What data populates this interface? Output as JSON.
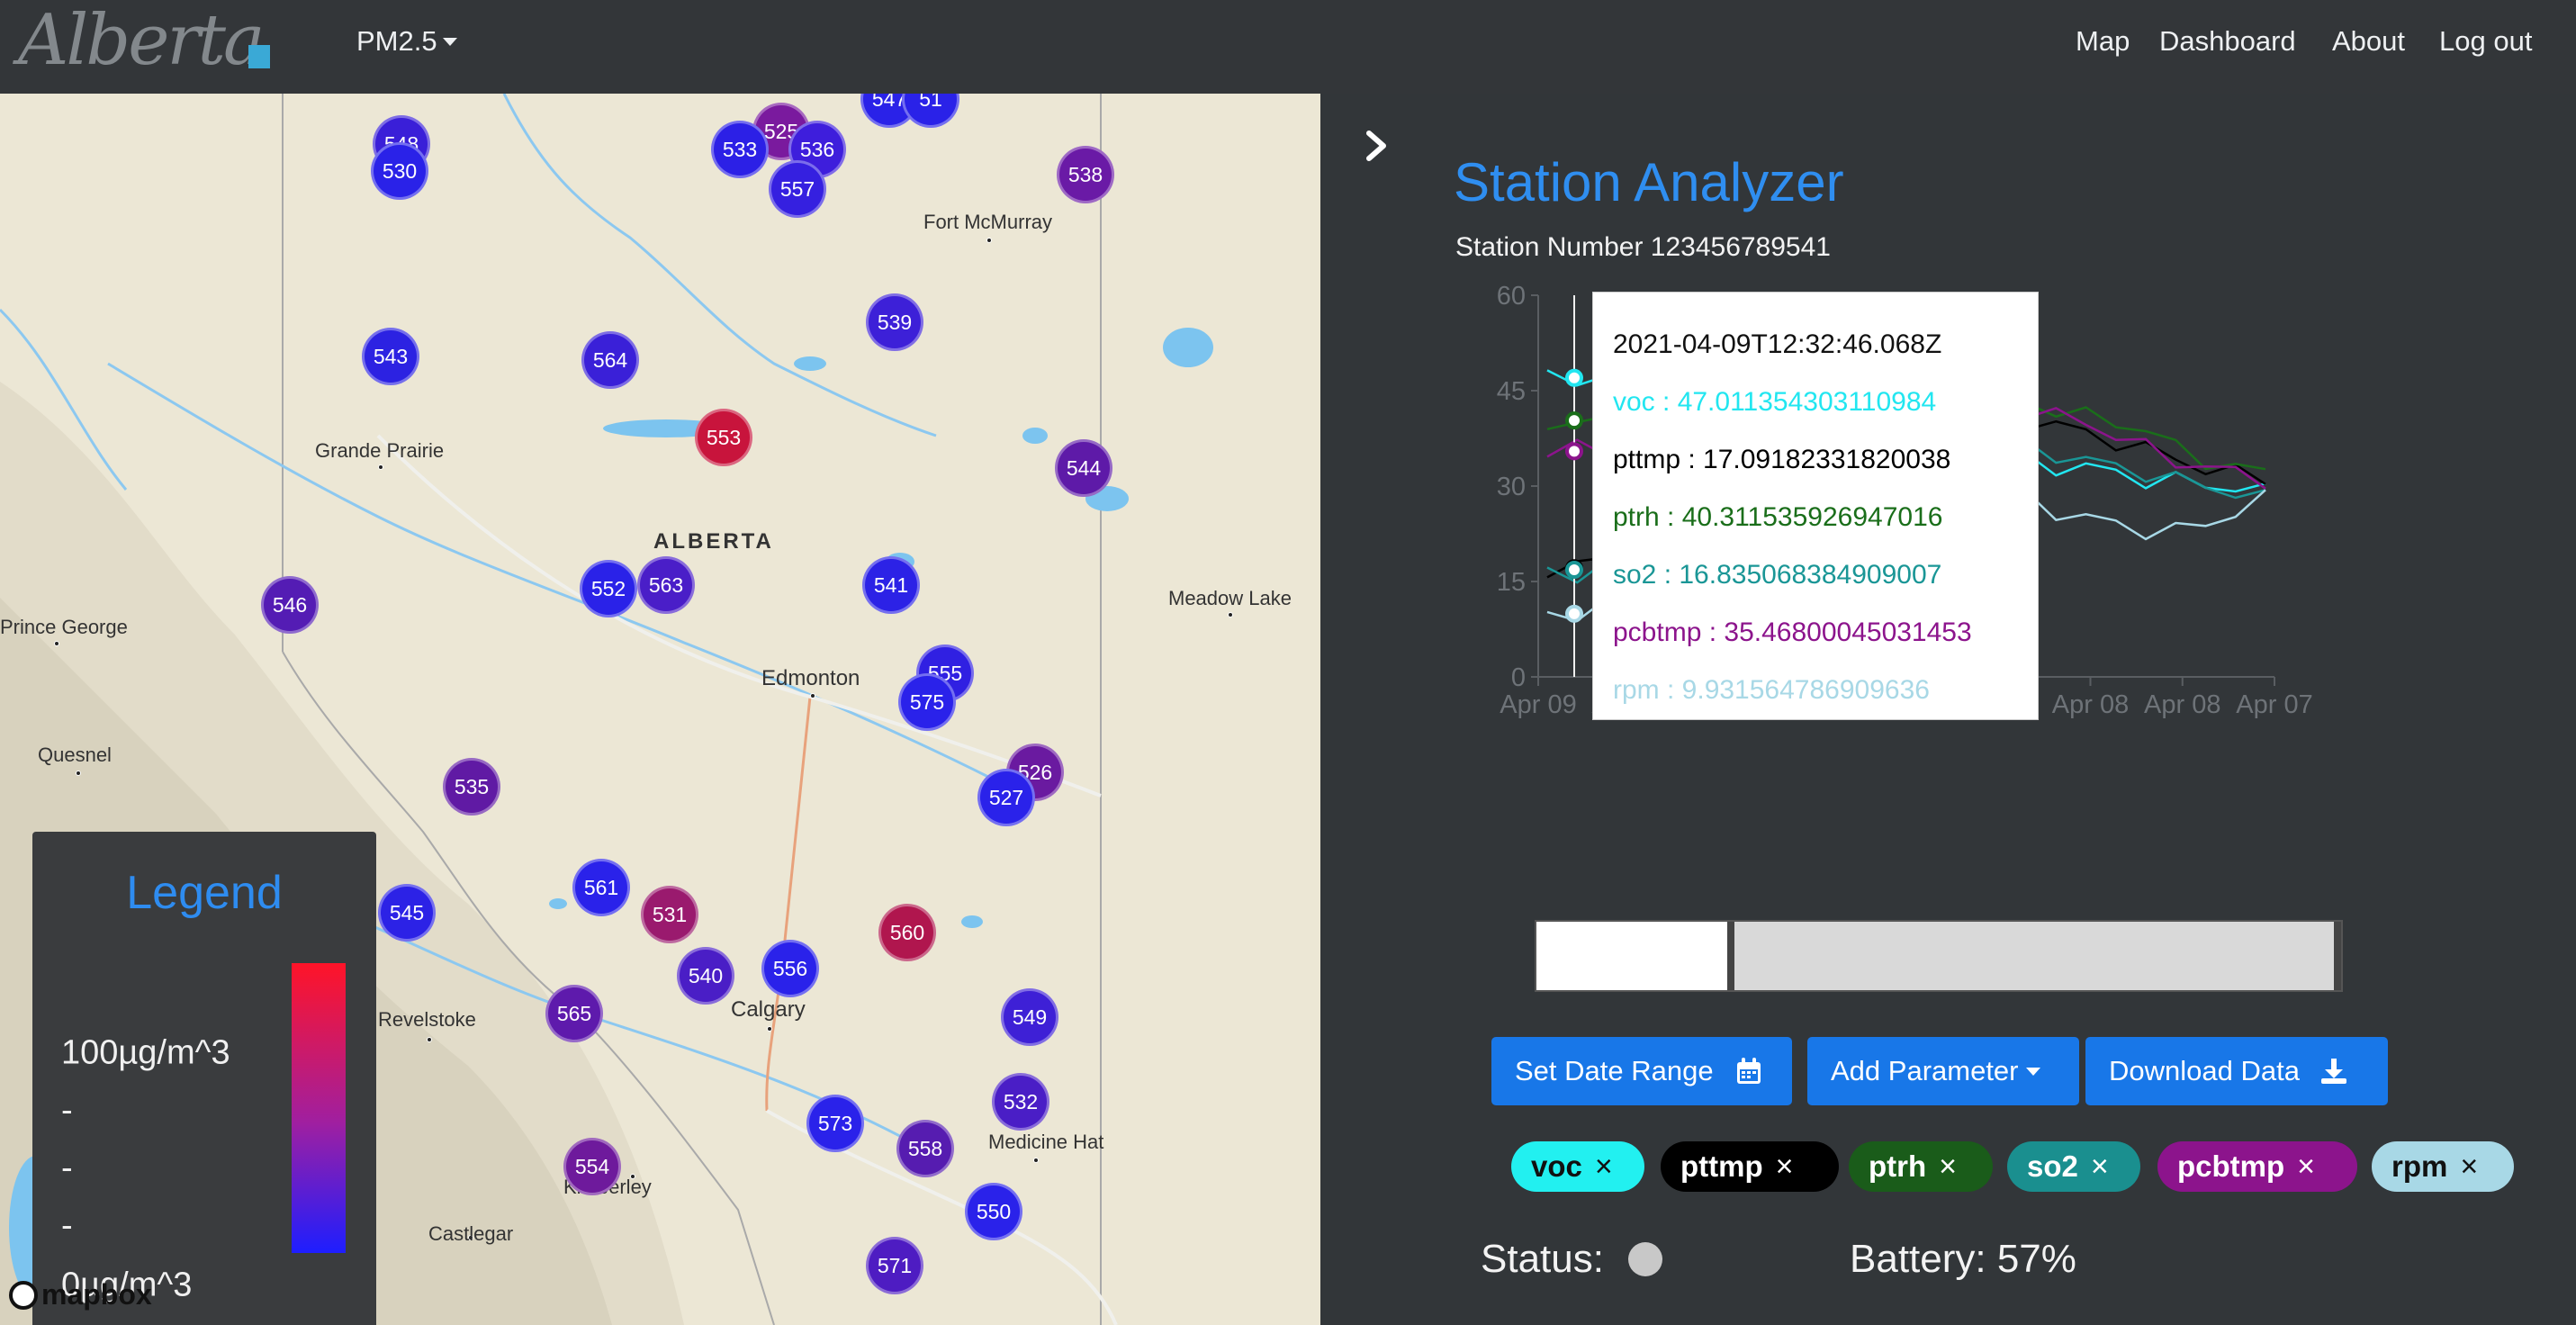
{
  "navbar": {
    "logo_text": "Alberta",
    "parameter_menu": "PM2.5",
    "links": [
      "Map",
      "Dashboard",
      "About",
      "Log out"
    ]
  },
  "map": {
    "region_label": "ALBERTA",
    "cities": [
      "Fort McMurray",
      "Grande Prairie",
      "Meadow Lake",
      "Prince George",
      "Edmonton",
      "Quesnel",
      "Revelstoke",
      "Calgary",
      "Medicine Hat",
      "Kimberley",
      "Castlegar"
    ],
    "markers": [
      "548",
      "530",
      "525",
      "533",
      "536",
      "547",
      "51",
      "557",
      "538",
      "543",
      "564",
      "539",
      "553",
      "544",
      "552",
      "563",
      "541",
      "546",
      "555",
      "575",
      "535",
      "526",
      "527",
      "545",
      "561",
      "531",
      "560",
      "556",
      "540",
      "565",
      "549",
      "532",
      "573",
      "558",
      "554",
      "550",
      "571"
    ],
    "attribution": "mapbox"
  },
  "legend": {
    "title": "Legend",
    "labels": [
      "100µg/m^3",
      "-",
      "-",
      "-",
      "0µg/m^3"
    ]
  },
  "panel": {
    "title": "Station Analyzer",
    "station_number": "Station Number 123456789541",
    "tooltip": {
      "timestamp": "2021-04-09T12:32:46.068Z",
      "rows": [
        {
          "text": "voc : 47.011354303110984",
          "color": "#22e6f0"
        },
        {
          "text": "pttmp : 17.09182331820038",
          "color": "#000000"
        },
        {
          "text": "ptrh : 40.311535926947016",
          "color": "#1a6e1a"
        },
        {
          "text": "so2 : 16.835068384909007",
          "color": "#1a9696"
        },
        {
          "text": "pcbtmp : 35.46800045031453",
          "color": "#8c148c"
        },
        {
          "text": "rpm : 9.931564786909636",
          "color": "#a8d8e6"
        }
      ]
    },
    "buttons": {
      "date_range": "Set Date Range",
      "add_parameter": "Add Parameter",
      "download": "Download Data"
    },
    "chips": [
      {
        "label": "voc",
        "bg": "#22f0f0",
        "fg": "#111"
      },
      {
        "label": "pttmp",
        "bg": "#000000",
        "fg": "#fff"
      },
      {
        "label": "ptrh",
        "bg": "#1a5c1a",
        "fg": "#fff"
      },
      {
        "label": "so2",
        "bg": "#1a8f8f",
        "fg": "#fff"
      },
      {
        "label": "pcbtmp",
        "bg": "#8c148c",
        "fg": "#fff"
      },
      {
        "label": "rpm",
        "bg": "#a8d8e6",
        "fg": "#111"
      }
    ],
    "status_label": "Status:",
    "battery": "Battery: 57%"
  },
  "chart_data": {
    "type": "line",
    "x_ticks": [
      "Apr 09",
      "Apr 09",
      "Apr 08",
      "Apr 08",
      "Apr 08",
      "Apr 08",
      "Apr 08",
      "Apr 08",
      "Apr 07"
    ],
    "y_ticks": [
      0,
      15,
      30,
      45,
      60
    ],
    "ylim": [
      0,
      60
    ],
    "series": [
      {
        "name": "voc",
        "color": "#22e6f0",
        "values": [
          48,
          47,
          46,
          44,
          43,
          42,
          41,
          40,
          40,
          40,
          39,
          38,
          37,
          36,
          36,
          35,
          34,
          33,
          33,
          32,
          31,
          31,
          30,
          30,
          29
        ]
      },
      {
        "name": "pttmp",
        "color": "#000000",
        "values": [
          17,
          17,
          19,
          20,
          22,
          24,
          27,
          30,
          33,
          37,
          40,
          43,
          45,
          43,
          42,
          41,
          40,
          40,
          38,
          37,
          36,
          34,
          33,
          32,
          31
        ]
      },
      {
        "name": "ptrh",
        "color": "#1a6e1a",
        "values": [
          40,
          40,
          40,
          41,
          41,
          42,
          42,
          42,
          43,
          43,
          44,
          45,
          46,
          45,
          44,
          44,
          43,
          42,
          41,
          40,
          39,
          36,
          34,
          33,
          32
        ]
      },
      {
        "name": "so2",
        "color": "#1a9696",
        "values": [
          17,
          16,
          17,
          18,
          19,
          20,
          22,
          24,
          27,
          30,
          34,
          37,
          39,
          38,
          37,
          36,
          36,
          35,
          34,
          33,
          32,
          31,
          30,
          29,
          28
        ]
      },
      {
        "name": "pcbtmp",
        "color": "#8c148c",
        "values": [
          35,
          36,
          36,
          37,
          38,
          39,
          40,
          41,
          42,
          43,
          44,
          45,
          46,
          45,
          44,
          43,
          42,
          41,
          40,
          38,
          36,
          34,
          33,
          32,
          31
        ]
      },
      {
        "name": "rpm",
        "color": "#a8d8e6",
        "values": [
          10,
          10,
          11,
          11,
          12,
          12,
          13,
          13,
          14,
          15,
          16,
          18,
          20,
          23,
          27,
          30,
          28,
          26,
          25,
          24,
          23,
          23,
          24,
          26,
          28
        ]
      }
    ]
  }
}
